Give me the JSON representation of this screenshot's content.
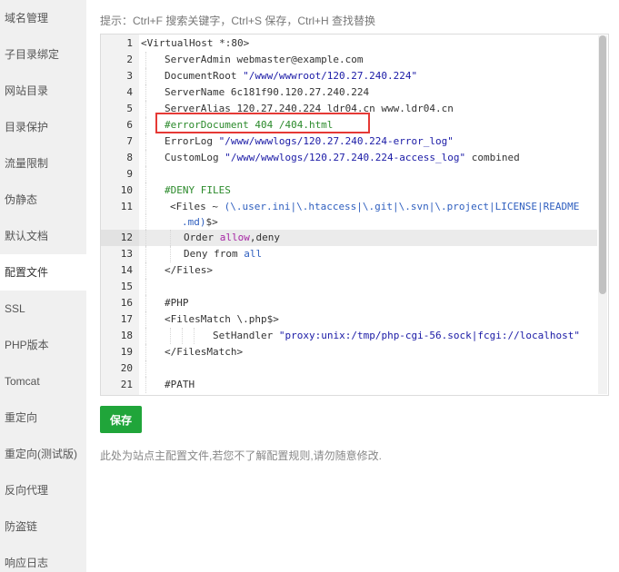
{
  "sidebar": {
    "items": [
      {
        "label": "域名管理"
      },
      {
        "label": "子目录绑定"
      },
      {
        "label": "网站目录"
      },
      {
        "label": "目录保护"
      },
      {
        "label": "流量限制"
      },
      {
        "label": "伪静态"
      },
      {
        "label": "默认文档"
      },
      {
        "label": "配置文件",
        "active": true
      },
      {
        "label": "SSL"
      },
      {
        "label": "PHP版本"
      },
      {
        "label": "Tomcat"
      },
      {
        "label": "重定向"
      },
      {
        "label": "重定向(测试版)"
      },
      {
        "label": "反向代理"
      },
      {
        "label": "防盗链"
      },
      {
        "label": "响应日志"
      }
    ]
  },
  "editor": {
    "hint": "提示：Ctrl+F 搜索关键字，Ctrl+S 保存，Ctrl+H 查找替换",
    "lines": [
      {
        "num": "1",
        "parts": [
          "<VirtualHost *:80>"
        ]
      },
      {
        "num": "2",
        "parts": [
          "ServerAdmin webmaster@example.com"
        ]
      },
      {
        "num": "3",
        "parts": [
          "DocumentRoot ",
          "\"/www/wwwroot/120.27.240.224\""
        ]
      },
      {
        "num": "4",
        "parts": [
          "ServerName 6c181f90.120.27.240.224"
        ]
      },
      {
        "num": "5",
        "parts": [
          "ServerAlias 120.27.240.224 ldr04.cn www.ldr04.cn"
        ]
      },
      {
        "num": "6",
        "parts": [
          "#errorDocument 404 /404.html"
        ]
      },
      {
        "num": "7",
        "parts": [
          "ErrorLog ",
          "\"/www/wwwlogs/120.27.240.224-error_log\""
        ]
      },
      {
        "num": "8",
        "parts": [
          "CustomLog ",
          "\"/www/wwwlogs/120.27.240.224-access_log\"",
          " combined"
        ]
      },
      {
        "num": "9",
        "parts": [
          ""
        ]
      },
      {
        "num": "10",
        "parts": [
          "#DENY FILES"
        ]
      },
      {
        "num": "11",
        "parts": [
          "<Files ~ ",
          "(\\.user.ini|\\.htaccess|\\.git|\\.svn|\\.project|LICENSE|README"
        ]
      },
      {
        "num": "",
        "parts": [
          ".md)",
          "$>"
        ]
      },
      {
        "num": "12",
        "parts": [
          "Order ",
          "allow",
          ",deny"
        ]
      },
      {
        "num": "13",
        "parts": [
          "Deny from ",
          "all"
        ]
      },
      {
        "num": "14",
        "parts": [
          "</Files>"
        ]
      },
      {
        "num": "15",
        "parts": [
          ""
        ]
      },
      {
        "num": "16",
        "parts": [
          "#PHP"
        ]
      },
      {
        "num": "17",
        "parts": [
          "<FilesMatch \\.php$>"
        ]
      },
      {
        "num": "18",
        "parts": [
          "SetHandler ",
          "\"proxy:unix:/tmp/php-cgi-56.sock|fcgi://localhost\""
        ]
      },
      {
        "num": "19",
        "parts": [
          "</FilesMatch>"
        ]
      },
      {
        "num": "20",
        "parts": [
          ""
        ]
      },
      {
        "num": "21",
        "parts": [
          "#PATH"
        ]
      }
    ]
  },
  "save_label": "保存",
  "note": "此处为站点主配置文件,若您不了解配置规则,请勿随意修改.",
  "colors": {
    "accent": "#20a53a",
    "highlight_box": "#e53935",
    "string": "#1a1aa6",
    "comment": "#2b8a2b"
  }
}
